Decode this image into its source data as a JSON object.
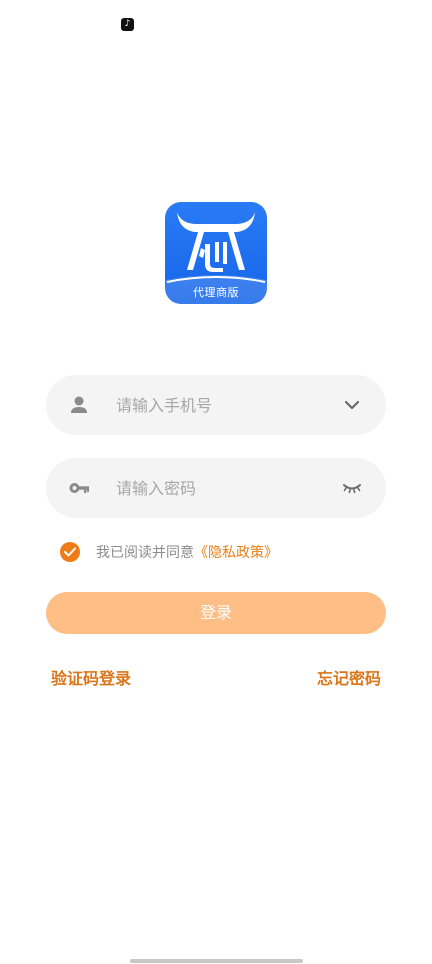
{
  "status_bar": {
    "notification_icon": "tiktok-icon",
    "notification_glyph": "♪"
  },
  "logo": {
    "caption": "代理商版",
    "icon": "bull-head-logo",
    "color": "#1f6ff0"
  },
  "phone_field": {
    "placeholder": "请输入手机号",
    "value": "",
    "leading_icon": "person-icon",
    "trailing_icon": "chevron-down-icon"
  },
  "password_field": {
    "placeholder": "请输入密码",
    "value": "",
    "leading_icon": "key-icon",
    "trailing_icon": "eye-closed-icon"
  },
  "agreement": {
    "checked": true,
    "text": "我已阅读并同意",
    "link": "《隐私政策》"
  },
  "login_button": {
    "label": "登录"
  },
  "links": {
    "sms_login": "验证码登录",
    "forgot_password": "忘记密码"
  },
  "colors": {
    "accent": "#f07c18",
    "button_disabled": "#ffbe86",
    "link": "#d9771a",
    "field_bg": "#f4f4f4"
  }
}
